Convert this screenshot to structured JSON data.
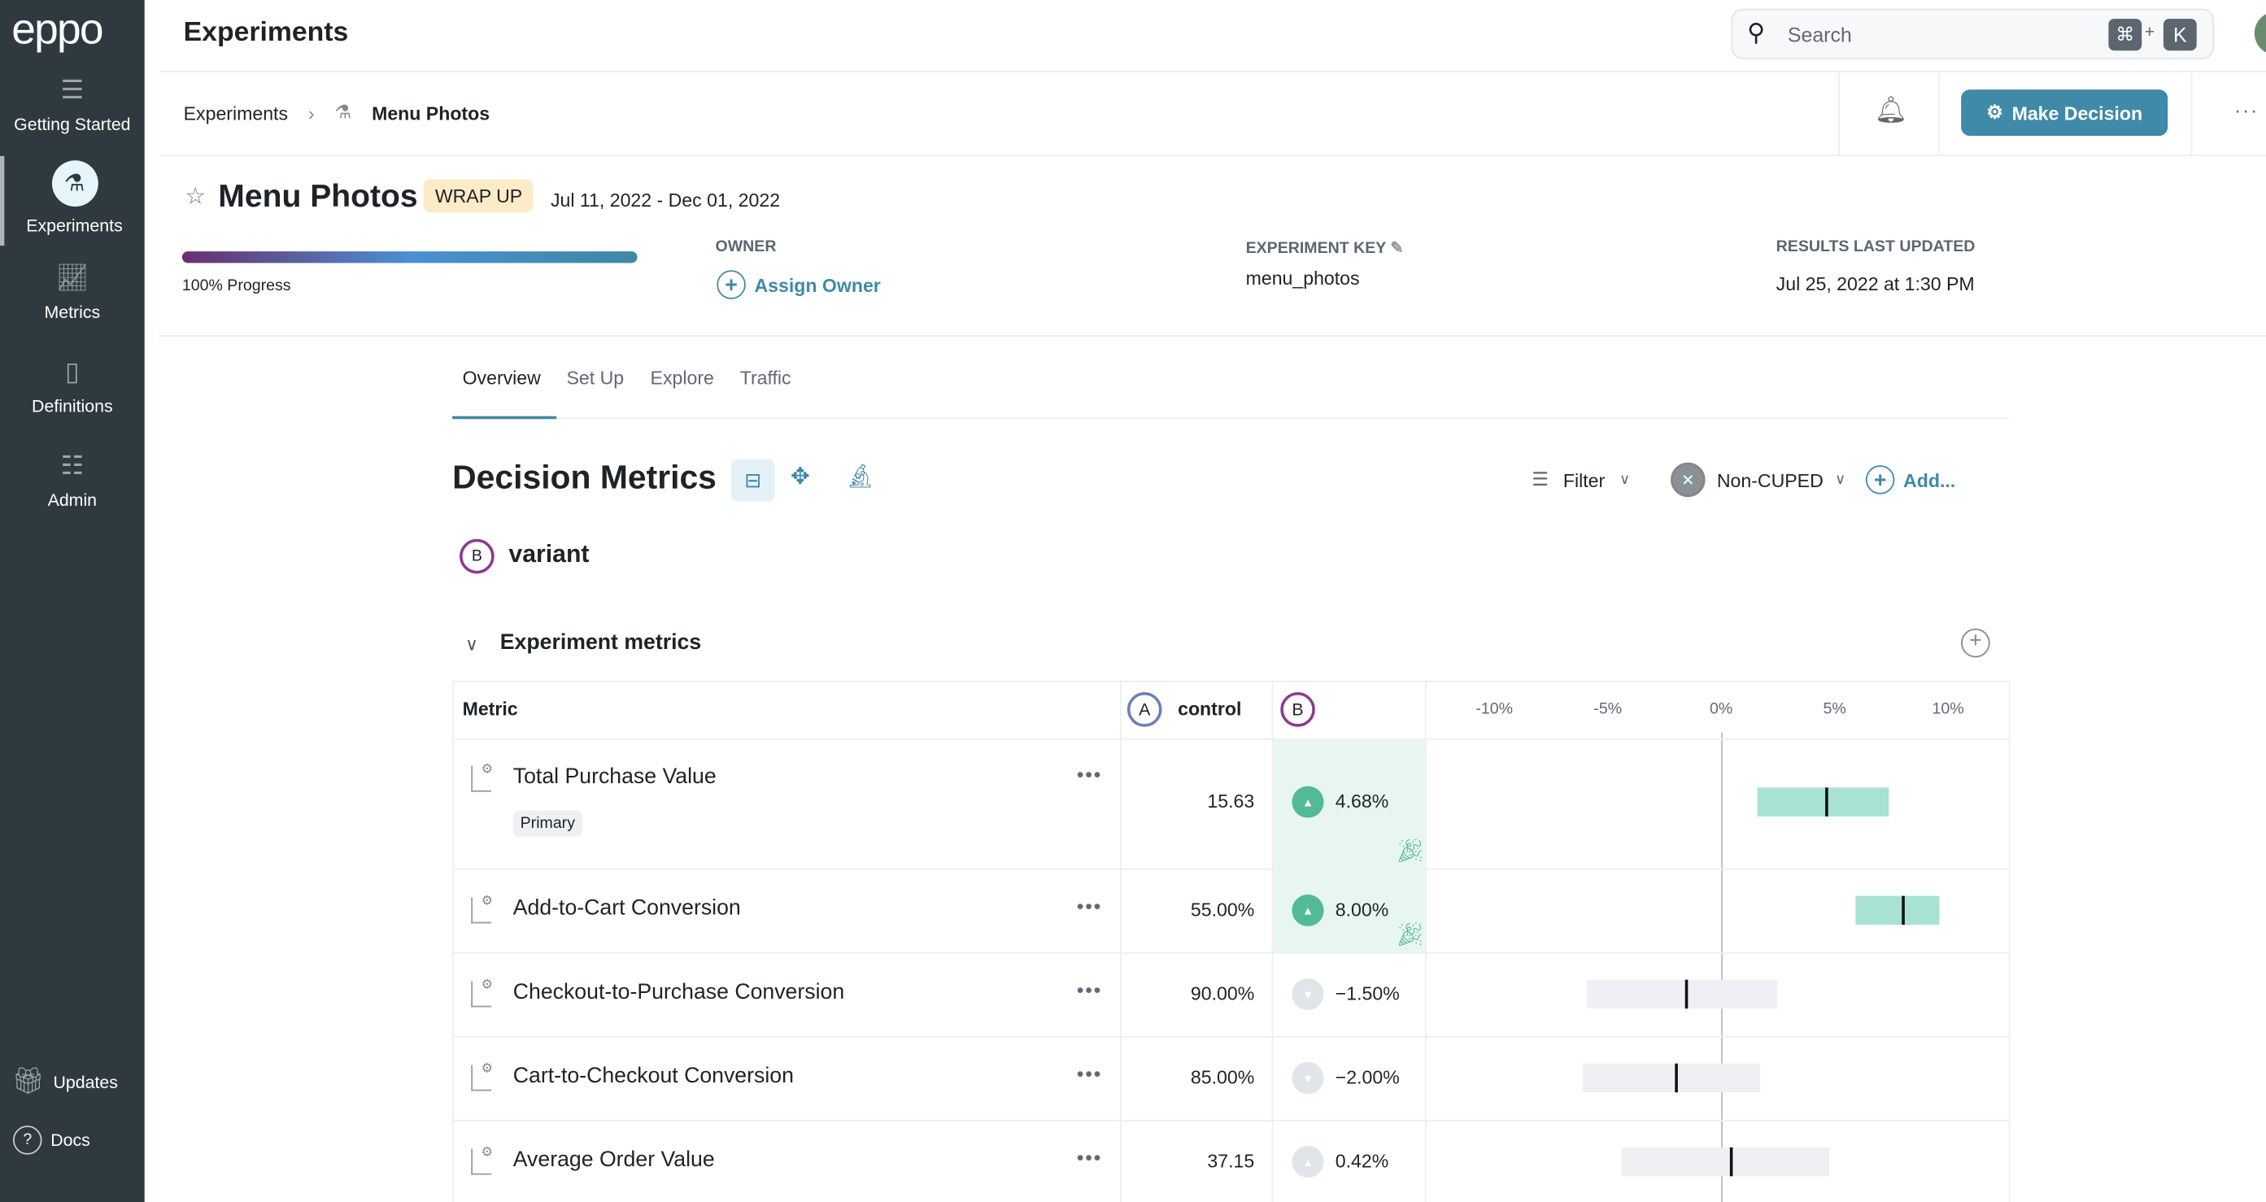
{
  "app": {
    "logo": "eppo",
    "page_title": "Experiments"
  },
  "sidebar": {
    "items": [
      {
        "label": "Getting Started",
        "icon": "list-icon"
      },
      {
        "label": "Experiments",
        "icon": "flask-icon",
        "active": true
      },
      {
        "label": "Metrics",
        "icon": "chart-line-icon"
      },
      {
        "label": "Definitions",
        "icon": "book-icon"
      },
      {
        "label": "Admin",
        "icon": "sliders-icon"
      }
    ],
    "bottom": [
      {
        "label": "Updates",
        "icon": "gift-icon"
      },
      {
        "label": "Docs",
        "icon": "help-icon"
      }
    ]
  },
  "search": {
    "placeholder": "Search",
    "shortcut_cmd": "⌘",
    "shortcut_plus": "+",
    "shortcut_key": "K"
  },
  "breadcrumb": {
    "root": "Experiments",
    "current": "Menu Photos"
  },
  "actions": {
    "make_decision": "Make Decision",
    "more": "···"
  },
  "experiment": {
    "title": "Menu Photos",
    "status": "WRAP UP",
    "dates": "Jul 11, 2022 - Dec 01, 2022",
    "progress": 100,
    "progress_label": "100% Progress",
    "owner_label": "OWNER",
    "assign_owner": "Assign Owner",
    "key_label": "EXPERIMENT KEY",
    "key": "menu_photos",
    "updated_label": "RESULTS LAST UPDATED",
    "updated": "Jul 25, 2022 at 1:30 PM"
  },
  "tabs": [
    {
      "label": "Overview",
      "active": true
    },
    {
      "label": "Set Up"
    },
    {
      "label": "Explore"
    },
    {
      "label": "Traffic"
    }
  ],
  "decision": {
    "title": "Decision Metrics",
    "filter": "Filter",
    "cuped": "Non-CUPED",
    "add": "Add...",
    "variant_badge": "B",
    "variant": "variant",
    "section": "Experiment metrics"
  },
  "table": {
    "col_metric": "Metric",
    "control_badge": "A",
    "control": "control",
    "variant_badge": "B",
    "axis_ticks": [
      "-10%",
      "-5%",
      "0%",
      "5%",
      "10%"
    ],
    "rows": [
      {
        "name": "Total Purchase Value",
        "tag": "Primary",
        "control": "15.63",
        "lift": "4.68%",
        "dir": "up",
        "significant": true,
        "ci": [
          1.6,
          7.4
        ],
        "point": 4.68
      },
      {
        "name": "Add-to-Cart Conversion",
        "control": "55.00%",
        "lift": "8.00%",
        "dir": "up",
        "significant": true,
        "ci": [
          5.9,
          9.6
        ],
        "point": 8.0
      },
      {
        "name": "Checkout-to-Purchase Conversion",
        "control": "90.00%",
        "lift": "−1.50%",
        "dir": "down",
        "significant": false,
        "ci": [
          -5.9,
          2.5
        ],
        "point": -1.5
      },
      {
        "name": "Cart-to-Checkout Conversion",
        "control": "85.00%",
        "lift": "−2.00%",
        "dir": "down",
        "significant": false,
        "ci": [
          -6.1,
          1.7
        ],
        "point": -2.0
      },
      {
        "name": "Average Order Value",
        "control": "37.15",
        "lift": "0.42%",
        "dir": "up",
        "significant": false,
        "ci": [
          -4.4,
          4.8
        ],
        "point": 0.42
      }
    ]
  },
  "colors": {
    "sidebar": "#2e3a40",
    "accent": "#3f8aa8",
    "positive": "#52bb96",
    "positive_bg": "#e8f6f1",
    "neutral_bar": "#eef0f4",
    "wrap_bg": "#fcebc7"
  }
}
